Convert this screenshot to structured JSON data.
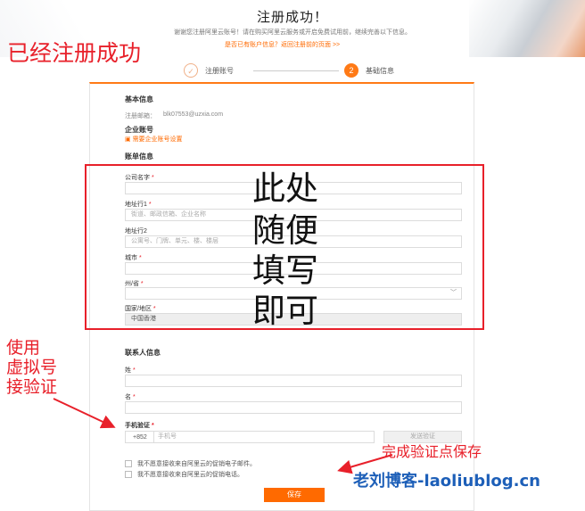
{
  "banner": {
    "title": "注册成功！",
    "subtitle": "谢谢您注册阿里云账号！请在购买阿里云服务或开启免费试用前，继续完善以下信息。",
    "link": "是否已有账户信息？返回注册前的页面 >>"
  },
  "annotations": {
    "registered": "已经注册成功",
    "fill_here": [
      "此处",
      "随便",
      "填写",
      "即可"
    ],
    "virtual_number": [
      "使用",
      "虚拟号",
      "接验证"
    ],
    "save_hint": "完成验证点保存",
    "watermark": "老刘博客-laoliublog.cn"
  },
  "steps": [
    {
      "label": "注册账号",
      "marker": "✓"
    },
    {
      "label": "基础信息",
      "marker": "2"
    }
  ],
  "form": {
    "basic_title": "基本信息",
    "email_label": "注册邮箱：",
    "email_value": "blk07553@uzxia.com",
    "enterprise_title": "企业账号",
    "enterprise_link": "需要企业账号设置",
    "billing_title": "账单信息",
    "company_label": "公司名字",
    "address1_label": "地址行1",
    "address1_placeholder": "街道、邮政信箱、企业名称",
    "address2_label": "地址行2",
    "address2_placeholder": "公寓号、门牌、单元、楼、楼层",
    "city_label": "城市",
    "state_label": "州/省",
    "country_label": "国家/地区",
    "country_value": "中国香港",
    "contact_title": "联系人信息",
    "last_name_label": "姓",
    "first_name_label": "名",
    "phone_label": "手机验证",
    "phone_prefix": "+852",
    "phone_placeholder": "手机号",
    "send_code": "发送验证",
    "checkbox1": "我不愿意接收来自阿里云的促销电子邮件。",
    "checkbox2": "我不愿意接收来自阿里云的促销电话。",
    "save": "保存"
  },
  "colors": {
    "accent": "#ff6a00",
    "annotation": "#e8202a",
    "watermark": "#1d5fb8"
  }
}
